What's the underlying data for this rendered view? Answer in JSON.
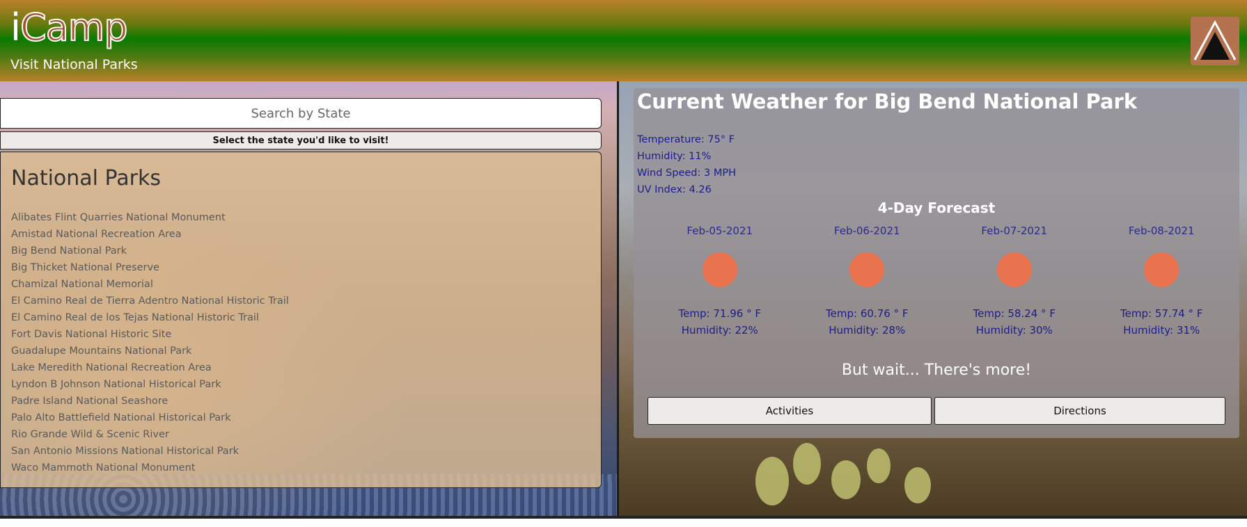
{
  "header": {
    "logo_i": "i",
    "logo_rest": "Camp",
    "tagline": "Visit National Parks",
    "menu_icon": "tent-icon"
  },
  "search": {
    "placeholder": "Search by State",
    "select_label": "Select the state you'd like to visit!"
  },
  "parks": {
    "title": "National Parks",
    "items": [
      "Alibates Flint Quarries National Monument",
      "Amistad National Recreation Area",
      "Big Bend National Park",
      "Big Thicket National Preserve",
      "Chamizal National Memorial",
      "El Camino Real de Tierra Adentro National Historic Trail",
      "El Camino Real de los Tejas National Historic Trail",
      "Fort Davis National Historic Site",
      "Guadalupe Mountains National Park",
      "Lake Meredith National Recreation Area",
      "Lyndon B Johnson National Historical Park",
      "Padre Island National Seashore",
      "Palo Alto Battlefield National Historical Park",
      "Rio Grande Wild & Scenic River",
      "San Antonio Missions National Historical Park",
      "Waco Mammoth National Monument"
    ]
  },
  "weather": {
    "title": "Current Weather for Big Bend National Park",
    "temperature": "Temperature: 75° F",
    "humidity": "Humidity: 11%",
    "wind": "Wind Speed: 3 MPH",
    "uv": "UV Index: 4.26",
    "forecast_title": "4-Day Forecast",
    "days": [
      {
        "date": "Feb-05-2021",
        "temp": "Temp: 71.96 ° F",
        "humidity": "Humidity: 22%",
        "icon": "sun-icon"
      },
      {
        "date": "Feb-06-2021",
        "temp": "Temp: 60.76 ° F",
        "humidity": "Humidity: 28%",
        "icon": "sun-icon"
      },
      {
        "date": "Feb-07-2021",
        "temp": "Temp: 58.24 ° F",
        "humidity": "Humidity: 30%",
        "icon": "sun-icon"
      },
      {
        "date": "Feb-08-2021",
        "temp": "Temp: 57.74 ° F",
        "humidity": "Humidity: 31%",
        "icon": "sun-icon"
      }
    ],
    "more_text": "But wait... There's more!",
    "activities_label": "Activities",
    "directions_label": "Directions"
  },
  "colors": {
    "logo": "#a0522d",
    "sun": "#e8734e",
    "weather_text": "#1c1c8c",
    "header_green": "#0a7a00"
  }
}
